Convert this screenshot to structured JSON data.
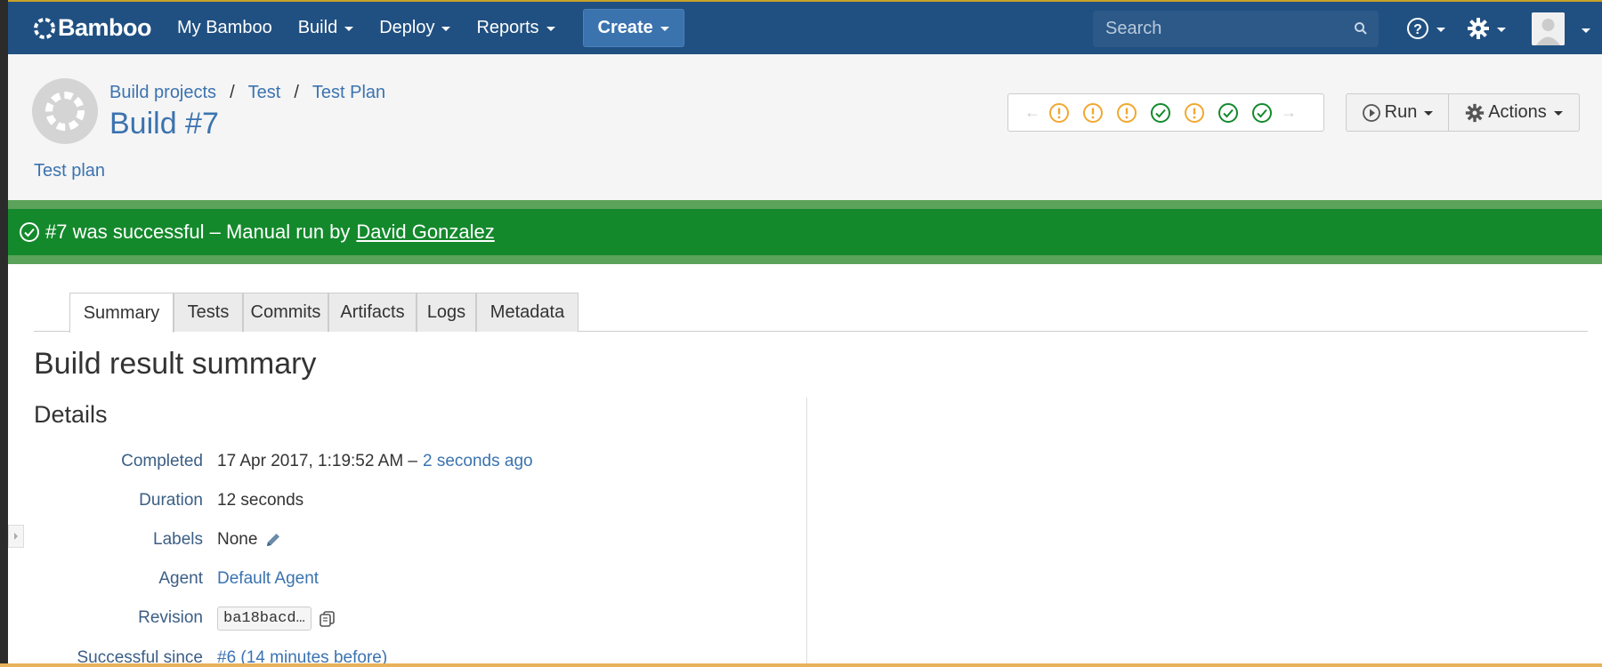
{
  "nav": {
    "logo": "Bamboo",
    "items": [
      "My Bamboo",
      "Build",
      "Deploy",
      "Reports"
    ],
    "create_label": "Create",
    "search_placeholder": "Search"
  },
  "header": {
    "breadcrumb": [
      "Build projects",
      "Test",
      "Test Plan"
    ],
    "title": "Build #7",
    "description": "Test plan",
    "history": [
      "warning",
      "warning",
      "warning",
      "success",
      "warning",
      "success",
      "success"
    ],
    "run_label": "Run",
    "actions_label": "Actions"
  },
  "banner": {
    "text": "#7 was successful – Manual run by",
    "user": "David Gonzalez"
  },
  "tabs": [
    "Summary",
    "Tests",
    "Commits",
    "Artifacts",
    "Logs",
    "Metadata"
  ],
  "summary": {
    "title": "Build result summary",
    "details_title": "Details",
    "completed_label": "Completed",
    "completed_value": "17 Apr 2017, 1:19:52 AM –",
    "completed_ago": "2 seconds ago",
    "duration_label": "Duration",
    "duration_value": "12 seconds",
    "labels_label": "Labels",
    "labels_value": "None",
    "agent_label": "Agent",
    "agent_value": "Default Agent",
    "revision_label": "Revision",
    "revision_value": "ba18bacd…",
    "since_label": "Successful since",
    "since_value": "#6 (14 minutes before)"
  },
  "colors": {
    "nav_bg": "#205081",
    "success": "#14892c",
    "warning": "#f0a830",
    "link": "#3b73af"
  }
}
